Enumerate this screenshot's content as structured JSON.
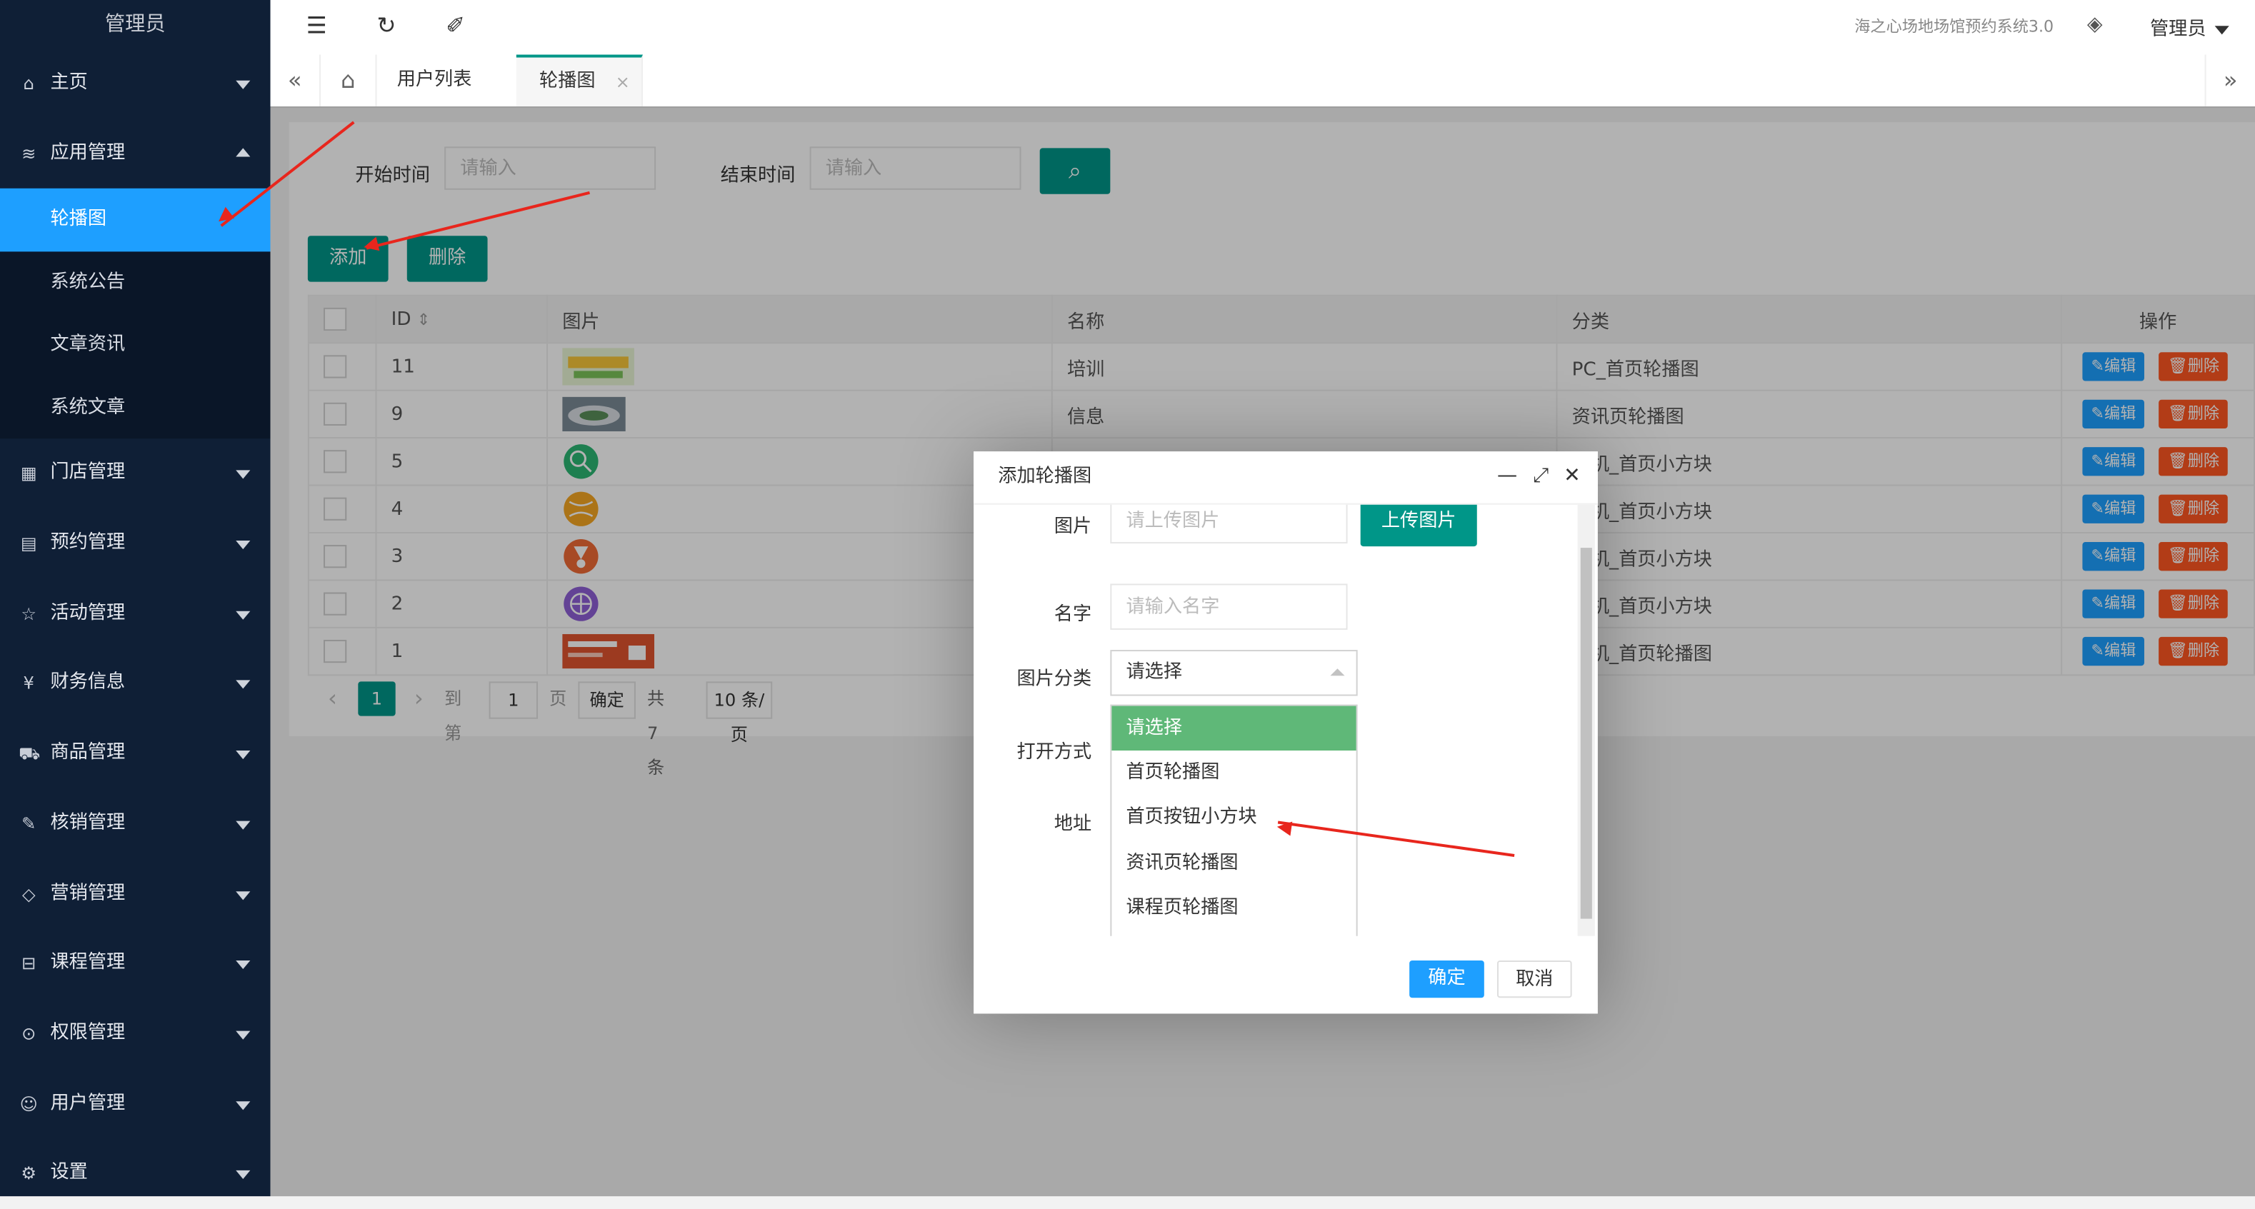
{
  "brand": "管理员",
  "sidebar": {
    "items": [
      {
        "label": "主页",
        "icon": "home-icon",
        "glyph": "⌂"
      },
      {
        "label": "应用管理",
        "icon": "layers-icon",
        "glyph": "≋"
      },
      {
        "label": "门店管理",
        "icon": "store-icon",
        "glyph": "▦"
      },
      {
        "label": "预约管理",
        "icon": "calendar-icon",
        "glyph": "▤"
      },
      {
        "label": "活动管理",
        "icon": "star-icon",
        "glyph": "☆"
      },
      {
        "label": "财务信息",
        "icon": "yen-icon",
        "glyph": "¥"
      },
      {
        "label": "商品管理",
        "icon": "cart-icon",
        "glyph": "⛟"
      },
      {
        "label": "核销管理",
        "icon": "edit-icon",
        "glyph": "✎"
      },
      {
        "label": "营销管理",
        "icon": "diamond-icon",
        "glyph": "◇"
      },
      {
        "label": "课程管理",
        "icon": "bus-icon",
        "glyph": "⊟"
      },
      {
        "label": "权限管理",
        "icon": "shield-icon",
        "glyph": "⊙"
      },
      {
        "label": "用户管理",
        "icon": "user-icon",
        "glyph": "☺"
      },
      {
        "label": "设置",
        "icon": "gear-icon",
        "glyph": "⚙"
      }
    ],
    "sub": [
      "轮播图",
      "系统公告",
      "文章资讯",
      "系统文章"
    ]
  },
  "header": {
    "system_name": "海之心场地场馆预约系统3.0",
    "user": "管理员",
    "menu_glyph": "☰",
    "refresh_glyph": "↻",
    "brush_glyph": "✐",
    "tag_glyph": "◈"
  },
  "tabs": {
    "items": [
      {
        "label": "用户列表"
      },
      {
        "label": "轮播图"
      }
    ],
    "close_glyph": "×",
    "left_glyph": "«",
    "right_glyph": "»",
    "home_glyph": "⌂"
  },
  "search": {
    "start_label": "开始时间",
    "start_placeholder": "请输入",
    "end_label": "结束时间",
    "end_placeholder": "请输入",
    "search_glyph": "⌕"
  },
  "toolbar": {
    "add": "添加",
    "delete": "删除"
  },
  "table": {
    "headers": [
      "ID",
      "图片",
      "名称",
      "分类",
      "操作"
    ],
    "sort_glyph": "⇕",
    "rows": [
      {
        "id": "11",
        "name": "培训",
        "category": "PC_首页轮播图"
      },
      {
        "id": "9",
        "name": "信息",
        "category": "资讯页轮播图"
      },
      {
        "id": "5",
        "name": "",
        "category": "手机_首页小方块"
      },
      {
        "id": "4",
        "name": "",
        "category": "手机_首页小方块"
      },
      {
        "id": "3",
        "name": "",
        "category": "手机_首页小方块"
      },
      {
        "id": "2",
        "name": "",
        "category": "手机_首页小方块"
      },
      {
        "id": "1",
        "name": "",
        "category": "手机_首页轮播图"
      }
    ],
    "edit": "✎编辑",
    "del": "🗑删除"
  },
  "pager": {
    "prev": "‹",
    "page": "1",
    "next": "›",
    "goto": "到第",
    "input": "1",
    "unit": "页",
    "confirm": "确定",
    "total": "共 7 条",
    "per_page": "10 条/页"
  },
  "modal": {
    "title": "添加轮播图",
    "min_glyph": "—",
    "max_glyph": "⤢",
    "close_glyph": "✕",
    "image_label": "图片",
    "image_placeholder": "请上传图片",
    "upload": "上传图片",
    "name_label": "名字",
    "name_placeholder": "请输入名字",
    "category_label": "图片分类",
    "category_value": "请选择",
    "open_label": "打开方式",
    "url_label": "地址",
    "options": [
      "请选择",
      "首页轮播图",
      "首页按钮小方块",
      "资讯页轮播图",
      "课程页轮播图"
    ],
    "ok": "确定",
    "cancel": "取消"
  },
  "colors": {
    "primary": "#009688",
    "accent": "#1e9fff",
    "danger": "#ff5722",
    "sidebar": "#0f1f36",
    "annotation": "#e8261d"
  }
}
